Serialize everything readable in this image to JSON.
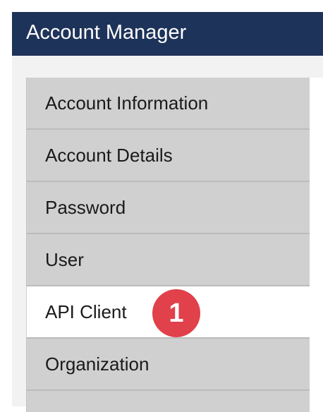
{
  "header": {
    "title": "Account Manager"
  },
  "nav": {
    "items": [
      {
        "label": "Account Information",
        "active": false
      },
      {
        "label": "Account Details",
        "active": false
      },
      {
        "label": "Password",
        "active": false
      },
      {
        "label": "User",
        "active": false
      },
      {
        "label": "API Client",
        "active": true
      },
      {
        "label": "Organization",
        "active": false
      }
    ]
  },
  "annotation": {
    "step_badge": "1"
  },
  "colors": {
    "header_bg": "#1e3359",
    "nav_bg": "#d0d0d0",
    "active_bg": "#ffffff",
    "badge_bg": "#e0414a"
  }
}
